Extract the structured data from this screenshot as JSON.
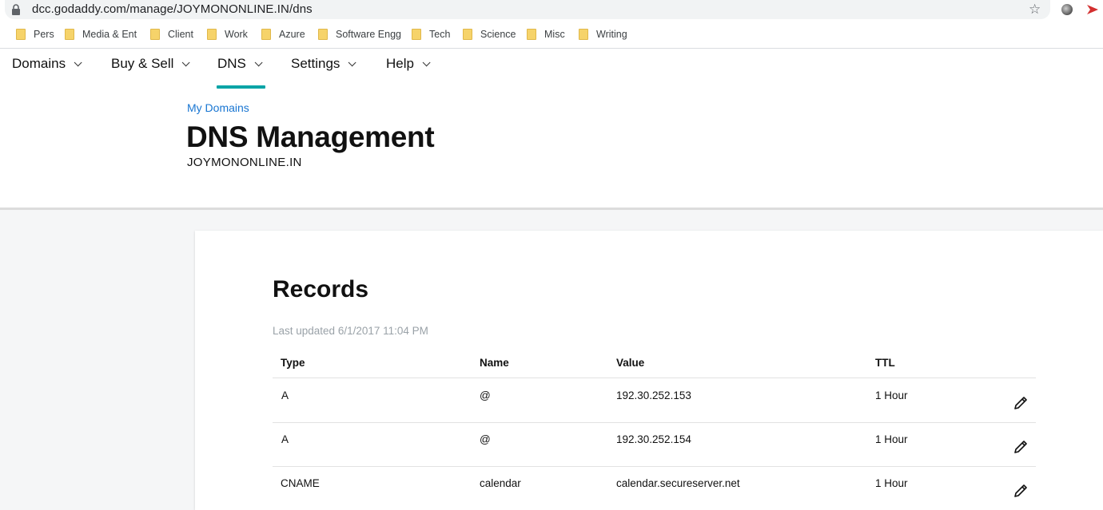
{
  "browser": {
    "url": "dcc.godaddy.com/manage/JOYMONONLINE.IN/dns",
    "bookmarks": [
      "Pers",
      "Media & Ent",
      "Client",
      "Work",
      "Azure",
      "Software Engg",
      "Tech",
      "Science",
      "Misc",
      "Writing"
    ]
  },
  "nav": {
    "items": [
      "Domains",
      "Buy & Sell",
      "DNS",
      "Settings",
      "Help"
    ],
    "active": "DNS"
  },
  "header": {
    "breadcrumb": "My Domains",
    "title": "DNS Management",
    "domain": "JOYMONONLINE.IN"
  },
  "records": {
    "title": "Records",
    "last_updated": "Last updated 6/1/2017 11:04 PM",
    "columns": [
      "Type",
      "Name",
      "Value",
      "TTL"
    ],
    "rows": [
      {
        "type": "A",
        "name": "@",
        "value": "192.30.252.153",
        "ttl": "1 Hour"
      },
      {
        "type": "A",
        "name": "@",
        "value": "192.30.252.154",
        "ttl": "1 Hour"
      },
      {
        "type": "CNAME",
        "name": "calendar",
        "value": "calendar.secureserver.net",
        "ttl": "1 Hour"
      }
    ]
  },
  "colors": {
    "accent": "#00a4a6",
    "link": "#1976d2",
    "muted": "#9aa2a8",
    "folder": "#f6d36a"
  },
  "icons": [
    "lock-icon",
    "star-icon",
    "extension-icon",
    "bookmark-folder-icon",
    "chevron-down-icon",
    "pencil-icon"
  ]
}
